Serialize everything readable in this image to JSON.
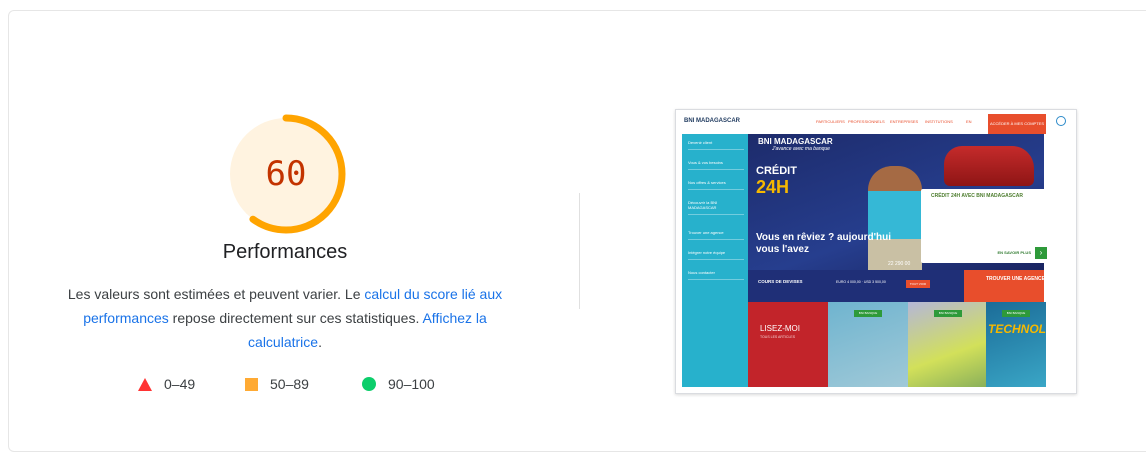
{
  "performance": {
    "score": "60",
    "score_fraction": 0.6,
    "score_color": "#ffa400",
    "title": "Performances",
    "description": {
      "part1": "Les valeurs sont estimées et peuvent varier. Le ",
      "link1": "calcul du score lié aux performances",
      "part2": " repose directement sur ces statistiques. ",
      "link2": "Affichez la calculatrice",
      "part3": "."
    },
    "legend": [
      {
        "icon": "triangle-fail-icon",
        "label": "0–49",
        "color": "#ff3333"
      },
      {
        "icon": "square-average-icon",
        "label": "50–89",
        "color": "#ffaa33"
      },
      {
        "icon": "circle-pass-icon",
        "label": "90–100",
        "color": "#0cce6b"
      }
    ]
  },
  "screenshot": {
    "logo": "BNI MADAGASCAR",
    "nav": [
      "PARTICULIERS",
      "PROFESSIONNELS",
      "ENTREPRISES",
      "INSTITUTIONS",
      "EN"
    ],
    "cta": "ACCÉDER À MES COMPTES",
    "sidebar": [
      "Devenir client",
      "Vous & vos besoins",
      "Nos offres & services",
      "Découvrir la BNI MADAGASCAR",
      "Trouver une agence",
      "Intégrer notre équipe",
      "Nous contacter"
    ],
    "hero_logo": "BNI MADAGASCAR",
    "hero_subtitle": "J'avance avec ma banque",
    "hero_credit": "CRÉDIT",
    "hero_credit_24h": "24H",
    "hero_tagline": "Vous en rêviez ? aujourd'hui vous l'avez",
    "hero_phone": "22 290 00",
    "panel_title": "CRÉDIT 24H AVEC BNI MADAGASCAR",
    "panel_more": "EN SAVOIR PLUS",
    "fx_title": "COURS DE DEVISES",
    "fx_rates": "EURO 4 000,00 · USD 3 500,00",
    "fx_button": "TOUT VOIR",
    "agence": "TROUVER UNE AGENCE",
    "lire": "LISEZ-MOI",
    "lire_sub": "TOUS LES ARTICLES",
    "tile_tag": "BNI BANQUE",
    "techno": "TECHNOL"
  }
}
